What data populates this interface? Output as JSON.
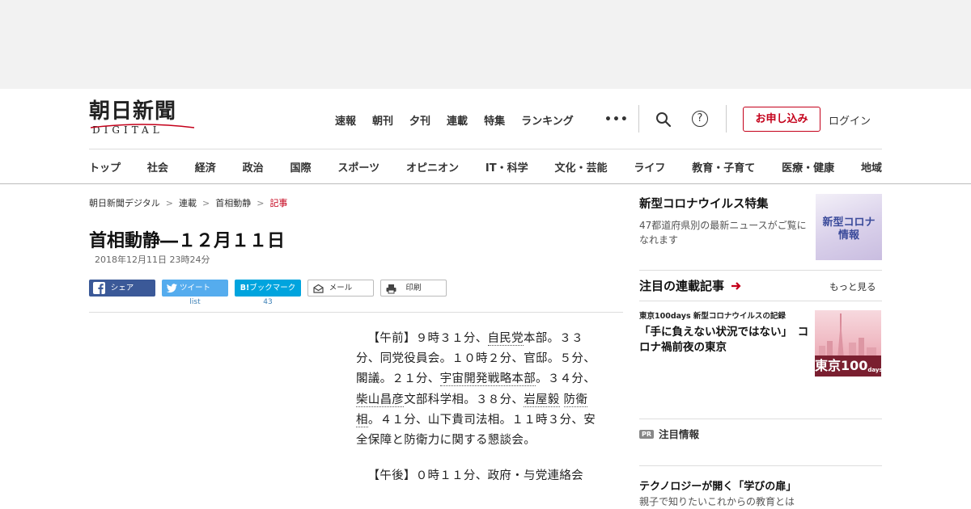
{
  "header": {
    "logo_main": "朝日新聞",
    "logo_sub": "DIGITAL",
    "top_nav": [
      "速報",
      "朝刊",
      "夕刊",
      "連載",
      "特集",
      "ランキング"
    ],
    "more_icon": "•••",
    "help_icon": "?",
    "subscribe_label": "お申し込み",
    "login_label": "ログイン"
  },
  "category_nav": [
    "トップ",
    "社会",
    "経済",
    "政治",
    "国際",
    "スポーツ",
    "オピニオン",
    "IT・科学",
    "文化・芸能",
    "ライフ",
    "教育・子育て",
    "医療・健康",
    "地域"
  ],
  "breadcrumb": {
    "items": [
      "朝日新聞デジタル",
      "連載",
      "首相動静"
    ],
    "current": "記事",
    "separator": ">"
  },
  "article": {
    "title": "首相動静―１２月１１日",
    "date": "2018年12月11日 23時24分",
    "paragraph1": {
      "s1": "【午前】９時３１分、",
      "k1": "自民党",
      "s2": "本部。３３分、同党役員会。１０時２分、官邸。５分、閣議。２１分、",
      "k2": "宇宙開発戦略本部",
      "s3": "。３４分、",
      "k3": "柴山昌彦",
      "s4": "文部科学相。３８分、",
      "k4": "岩屋毅",
      "s5": " ",
      "k5": "防衛相",
      "s6": "。４１分、山下貴司法相。１１時３分、安全保障と防衛力に関する懇談会。"
    },
    "paragraph2": "【午後】０時１１分、政府・与党連絡会"
  },
  "share": {
    "facebook": "シェア",
    "twitter": "ツイート",
    "hatena": "ブックマーク",
    "hatena_logo": "B!",
    "mail": "メール",
    "print": "印刷",
    "twitter_count": "list",
    "hatena_count": "43"
  },
  "sidebar": {
    "corona": {
      "title": "新型コロナウイルス特集",
      "desc": "47都道府県別の最新ニュースがご覧になれます",
      "thumb_text": "新型コロナ 情報"
    },
    "series": {
      "title": "注目の連載記事",
      "more": "もっと見る"
    },
    "tokyo": {
      "label": "東京100days 新型コロナウイルスの記録",
      "headline": "「手に負えない状況ではない」　コロナ禍前夜の東京",
      "thumb_text": "東京100",
      "thumb_sub": "days"
    },
    "pr": {
      "badge": "PR",
      "label": "注目情報"
    },
    "promo": {
      "title": "テクノロジーが開く「学びの扉」",
      "desc": "親子で知りたいこれからの教育とは"
    }
  },
  "colors": {
    "accent": "#c4001a",
    "facebook": "#3b5998",
    "twitter": "#55acee",
    "hatena": "#00a4de"
  }
}
